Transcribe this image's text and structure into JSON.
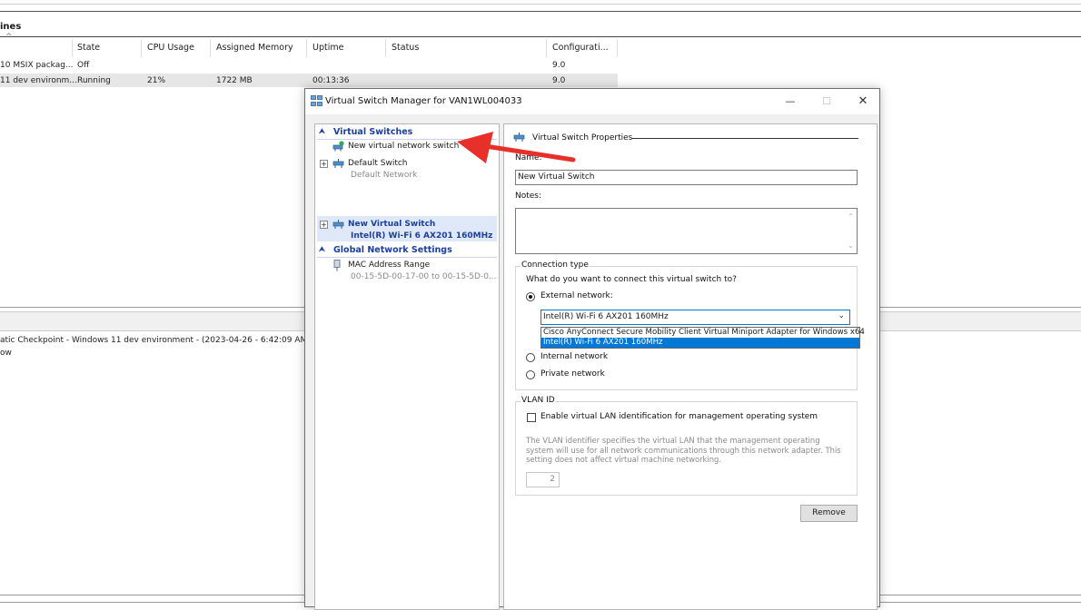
{
  "background": {
    "title": "ines",
    "columns": [
      "State",
      "CPU Usage",
      "Assigned Memory",
      "Uptime",
      "Status",
      "Configurati..."
    ],
    "vms": [
      {
        "name": "10 MSIX packag...",
        "state": "Off",
        "cpu": "",
        "memory": "",
        "uptime": "",
        "config": "9.0"
      },
      {
        "name": "11 dev environm...",
        "state": "Running",
        "cpu": "21%",
        "memory": "1722 MB",
        "uptime": "00:13:36",
        "config": "9.0"
      }
    ],
    "checkpoint_text": "atic Checkpoint - Windows 11 dev environment - (2023-04-26 - 6:42:09 AM)",
    "checkpoint_sub": "ow"
  },
  "dialog": {
    "title": "Virtual Switch Manager for VAN1WL004033",
    "tree": {
      "virtual_switches_header": "Virtual Switches",
      "new_switch": "New virtual network switch",
      "default_switch": "Default Switch",
      "default_switch_sub": "Default Network",
      "new_virtual_switch": "New Virtual Switch",
      "new_virtual_switch_sub": "Intel(R) Wi-Fi 6 AX201 160MHz",
      "global_header": "Global Network Settings",
      "mac_range": "MAC Address Range",
      "mac_range_sub": "00-15-5D-00-17-00 to 00-15-5D-0..."
    },
    "props": {
      "section_title": "Virtual Switch Properties",
      "name_label": "Name:",
      "name_value": "New Virtual Switch",
      "notes_label": "Notes:",
      "connection_type_title": "Connection type",
      "connection_question": "What do you want to connect this virtual switch to?",
      "external_label": "External network:",
      "selected_adapter": "Intel(R) Wi-Fi 6 AX201 160MHz",
      "adapter_options": [
        "Cisco AnyConnect Secure Mobility Client Virtual Miniport Adapter for Windows x64",
        "Intel(R) Wi-Fi 6 AX201 160MHz"
      ],
      "internal_label": "Internal network",
      "private_label": "Private network",
      "vlan_title": "VLAN ID",
      "vlan_checkbox_label": "Enable virtual LAN identification for management operating system",
      "vlan_desc": "The VLAN identifier specifies the virtual LAN that the management operating system will use for all network communications through this network adapter. This setting does not affect virtual machine networking.",
      "vlan_value": "2",
      "remove_button": "Remove"
    }
  },
  "colors": {
    "arrow": "#e8302b",
    "selection": "#0078d7",
    "tree_header": "#1b3f9c"
  }
}
